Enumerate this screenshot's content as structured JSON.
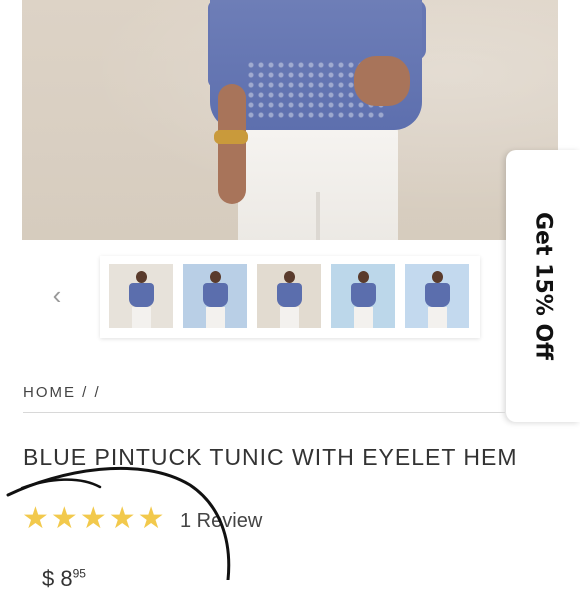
{
  "gallery": {
    "prev_arrow_icon": "chevron-left-icon",
    "thumbnails": [
      {
        "label": "thumbnail-1",
        "bg": "#e7e2da",
        "active": true
      },
      {
        "label": "thumbnail-2",
        "bg": "#b9cfe6"
      },
      {
        "label": "thumbnail-3",
        "bg": "#e2dbd0"
      },
      {
        "label": "thumbnail-4",
        "bg": "#bcd7ea"
      },
      {
        "label": "thumbnail-5",
        "bg": "#c3d9ee"
      }
    ]
  },
  "promo": {
    "label": "Get 15% Off"
  },
  "breadcrumb": {
    "text": "HOME / /"
  },
  "product": {
    "title": "BLUE PINTUCK TUNIC WITH EYELET HEM",
    "rating": 5,
    "review_count": "1 Review",
    "price_main": "$ 8",
    "price_cents": "95"
  },
  "colors": {
    "star": "#f2c94c",
    "blouse": "#5d6fae",
    "annotation_ink": "#111111"
  }
}
